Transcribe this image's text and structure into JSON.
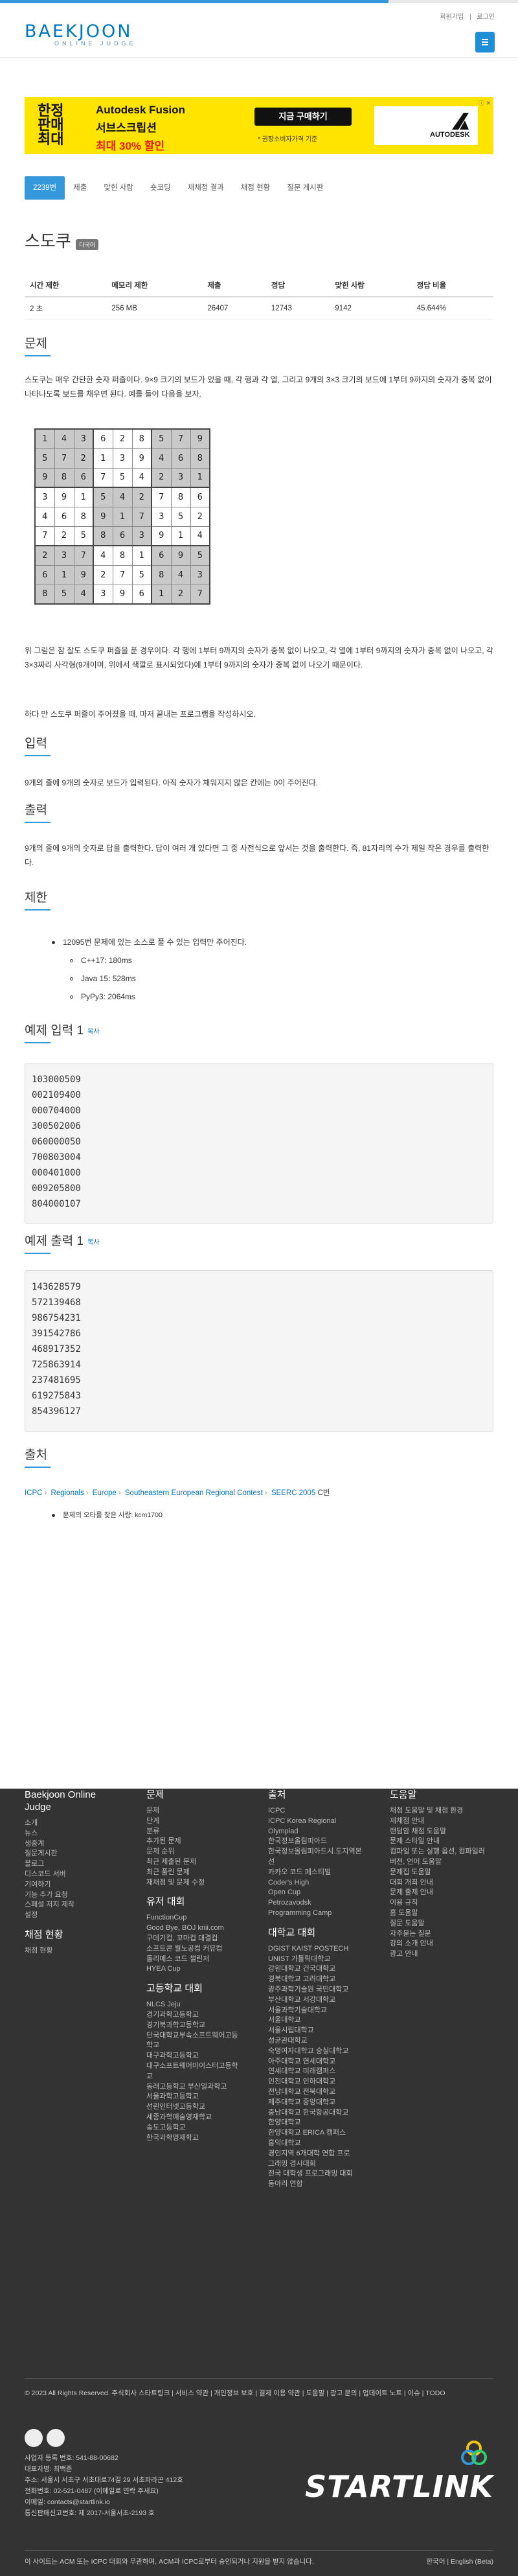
{
  "header": {
    "logo_main": "BAEKJOON",
    "logo_sub": "ONLINE JUDGE",
    "links": [
      "회원가입",
      "로그인"
    ]
  },
  "ad": {
    "left": [
      "한정",
      "판매",
      "최대"
    ],
    "line1": "Autodesk Fusion",
    "line2": "서브스크립션",
    "line3": "최대 30% 할인",
    "cta": "지금 구매하기",
    "note": "* 권장소비자가격 기준",
    "brand": "AUTODESK",
    "close": "ⓘ ✕"
  },
  "tabs": [
    "2239번",
    "제출",
    "맞힌 사람",
    "숏코딩",
    "재채점 결과",
    "채점 현황",
    "질문 게시판"
  ],
  "problem": {
    "title": "스도쿠",
    "badge": "다국어"
  },
  "info_table": {
    "headers": [
      "시간 제한",
      "메모리 제한",
      "제출",
      "정답",
      "맞힌 사람",
      "정답 비율"
    ],
    "row": [
      "2 초",
      "256 MB",
      "26407",
      "12743",
      "9142",
      "45.644%"
    ]
  },
  "sections": {
    "problem": "문제",
    "input": "입력",
    "output": "출력",
    "limits": "제한",
    "sample_in": "예제 입력 1",
    "sample_out": "예제 출력 1",
    "copy": "복사",
    "source": "출처"
  },
  "problem_text": {
    "p1": "스도쿠는 매우 간단한 숫자 퍼즐이다. 9×9 크기의 보드가 있을 때, 각 행과 각 열, 그리고 9개의 3×3 크기의 보드에 1부터 9까지의 숫자가 중복 없이 나타나도록 보드를 채우면 된다. 예를 들어 다음을 보자.",
    "p2": "위 그림은 참 잘도 스도쿠 퍼즐을 푼 경우이다. 각 행에 1부터 9까지의 숫자가 중복 없이 나오고, 각 열에 1부터 9까지의 숫자가 중복 없이 나오고, 각 3×3짜리 사각형(9개이며, 위에서 색깔로 표시되었다)에 1부터 9까지의 숫자가 중복 없이 나오기 때문이다.",
    "p3": "하다 만 스도쿠 퍼즐이 주어졌을 때, 마저 끝내는 프로그램을 작성하시오."
  },
  "sudoku": [
    [
      1,
      4,
      3,
      6,
      2,
      8,
      5,
      7,
      9
    ],
    [
      5,
      7,
      2,
      1,
      3,
      9,
      4,
      6,
      8
    ],
    [
      9,
      8,
      6,
      7,
      5,
      4,
      2,
      3,
      1
    ],
    [
      3,
      9,
      1,
      5,
      4,
      2,
      7,
      8,
      6
    ],
    [
      4,
      6,
      8,
      9,
      1,
      7,
      3,
      5,
      2
    ],
    [
      7,
      2,
      5,
      8,
      6,
      3,
      9,
      1,
      4
    ],
    [
      2,
      3,
      7,
      4,
      8,
      1,
      6,
      9,
      5
    ],
    [
      6,
      1,
      9,
      2,
      7,
      5,
      8,
      4,
      3
    ],
    [
      8,
      5,
      4,
      3,
      9,
      6,
      1,
      2,
      7
    ]
  ],
  "input_text": "9개의 줄에 9개의 숫자로 보드가 입력된다. 아직 숫자가 채워지지 않은 칸에는 0이 주어진다.",
  "output_text": "9개의 줄에 9개의 숫자로 답을 출력한다. 답이 여러 개 있다면 그 중 사전식으로 앞서는 것을 출력한다. 즉, 81자리의 수가 제일 작은 경우를 출력한다.",
  "limits": {
    "main": "12095번 문제에 있는 소스로 풀 수 있는 입력만 주어진다.",
    "sub": [
      "C++17: 180ms",
      "Java 15: 528ms",
      "PyPy3: 2064ms"
    ]
  },
  "sample_input": "103000509\n002109400\n000704000\n300502006\n060000050\n700803004\n000401000\n009205800\n804000107",
  "sample_output": "143628579\n572139468\n986754231\n391542786\n468917352\n725863914\n237481695\n619275843\n854396127",
  "source": {
    "crumbs": [
      "ICPC",
      "Regionals",
      "Europe",
      "Southeastern European Regional Contest",
      "SEERC 2005"
    ],
    "tail": "C번",
    "note": "문제의 오타를 찾은 사람: kcm1700"
  },
  "footer": {
    "col1": {
      "title": "Baekjoon Online Judge",
      "links": [
        "소개",
        "뉴스",
        "생중계",
        "질문게시판",
        "블로그",
        "디스코드 서버",
        "기여하기",
        "기능 추가 요청",
        "스페셜 저지 제작",
        "설정"
      ],
      "title2": "채점 현황",
      "links2": [
        "채점 현황"
      ]
    },
    "col2": {
      "title": "문제",
      "links": [
        "문제",
        "단계",
        "분류",
        "추가된 문제",
        "문제 순위",
        "최근 제출된 문제",
        "최근 풀린 문제",
        "재채점 및 문제 수정"
      ],
      "title2": "유저 대회",
      "links2": [
        "FunctionCup",
        "Good Bye, BOJ kriii.com",
        "구데기컵, 꼬마컵 대결컵",
        "소프트콘 월노공컵 커뮤컵",
        "돌리메스 코드 챌린저",
        "HYEA Cup"
      ],
      "title3": "고등학교 대회",
      "links3": [
        "NLCS Jeju",
        "경기과학고등학교",
        "경기북과학고등학교",
        "단국대학교부속소프트웨어고등학교",
        "대구과학고등학교",
        "대구소프트웨어마이스터고등학교",
        "동래고등학교 부산일과학고",
        "서울과학고등학교",
        "선린인터넷고등학교",
        "세종과학예술영재학교",
        "송도고등학교",
        "한국과학영재학교"
      ]
    },
    "col3": {
      "title": "출처",
      "links": [
        "ICPC",
        "ICPC Korea Regional",
        "Olympiad",
        "한국정보올림피아드",
        "한국정보올림피아드시.도지역본선",
        "카카오 코드 페스티벌",
        "Coder's High",
        "Open Cup",
        "Petrozavodsk",
        "Programming Camp"
      ],
      "title2": "대학교 대회",
      "links2": [
        "DGIST KAIST POSTECH",
        "UNIST 가톨릭대학교",
        "강원대학교 건국대학교",
        "경북대학교 고려대학교",
        "광주과학기술원 국민대학교",
        "부산대학교 서강대학교",
        "서울과학기술대학교",
        "서울대학교",
        "서울시립대학교",
        "성균관대학교",
        "숙명여자대학교 숭실대학교",
        "아주대학교 연세대학교",
        "연세대학교 미래캠퍼스",
        "인천대학교 인하대학교",
        "전남대학교 전북대학교",
        "제주대학교 중앙대학교",
        "충남대학교 한국항공대학교",
        "한양대학교",
        "한양대학교 ERICA 캠퍼스",
        "홍익대학교",
        "경인지역 6개대학 연합 프로",
        "그래밍 경시대회",
        "전국 대학생 프로그래밍 대회",
        "동아리 연합"
      ]
    },
    "col4": {
      "title": "도움말",
      "links": [
        "채점 도움말 및 채점 환경",
        "재채점 안내",
        "랜덤암 채점 도움말",
        "문제 스타일 안내",
        "컴파일 또는 실행 옵션, 컴파일러 버전, 언어 도움말",
        "문제집 도움말",
        "대회 개최 안내",
        "문제 출제 안내",
        "이용 규칙",
        "홈 도움말",
        "질문 도움말",
        "자주묻는 질문",
        "강의 소개 안내",
        "광고 안내"
      ]
    },
    "bottom_links": "© 2023 All Rights Reserved. 주식회사 스타트링크 | 서비스 약관 | 개인정보 보호 | 결제 이용 약관 | 도움말 | 광고 문의 | 업데이트 노트 | 이슈 | TODO",
    "company": [
      "사업자 등록 번호: 541-88-00682",
      "대표자명: 최백준",
      "주소: 서울시 서초구 서초대로74길 29 서초파라곤 412호",
      "전화번호: 02-521-0487 (이메일로 연락 주세요)",
      "이메일: contacts@startlink.io",
      "통신판매신고번호: 제 2017-서울서초-2193 호"
    ],
    "last_line": "이 사이트는 ACM 또는 ICPC 대회와 무관하며, ACM과 ICPC로부터 승인되거나 지원을 받지 않습니다.",
    "lang": "한국어 | English (Beta)",
    "brand": "STARTLINK"
  }
}
